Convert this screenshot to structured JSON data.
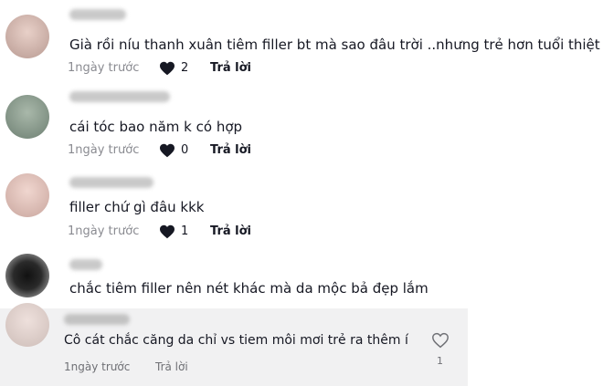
{
  "comments": [
    {
      "text": "Già rồi níu thanh xuân tiêm filler bt mà sao đâu trời ..nhưng trẻ hơn tuổi thiệt mà",
      "time": "1ngày trước",
      "likes": "2",
      "reply": "Trả lời"
    },
    {
      "text": "cái tóc bao năm k có hợp",
      "time": "1ngày trước",
      "likes": "0",
      "reply": "Trả lời"
    },
    {
      "text": "filler chứ gì đâu kkk",
      "time": "1ngày trước",
      "likes": "1",
      "reply": "Trả lời"
    },
    {
      "text": "chắc tiêm filler nên nét khác mà da mộc bả đẹp lắm"
    },
    {
      "text": "Cô cát chắc căng da chỉ vs tiem môi mơi trẻ ra thêm í",
      "time": "1ngày trước",
      "likes": "1",
      "reply": "Trả lời"
    }
  ],
  "colors": {
    "heart_filled": "#161823",
    "meta_text": "#8a8b91",
    "highlight_bg": "#f1f1f2"
  },
  "icons": {
    "like": "heart-icon",
    "like_outline": "heart-outline-icon"
  }
}
